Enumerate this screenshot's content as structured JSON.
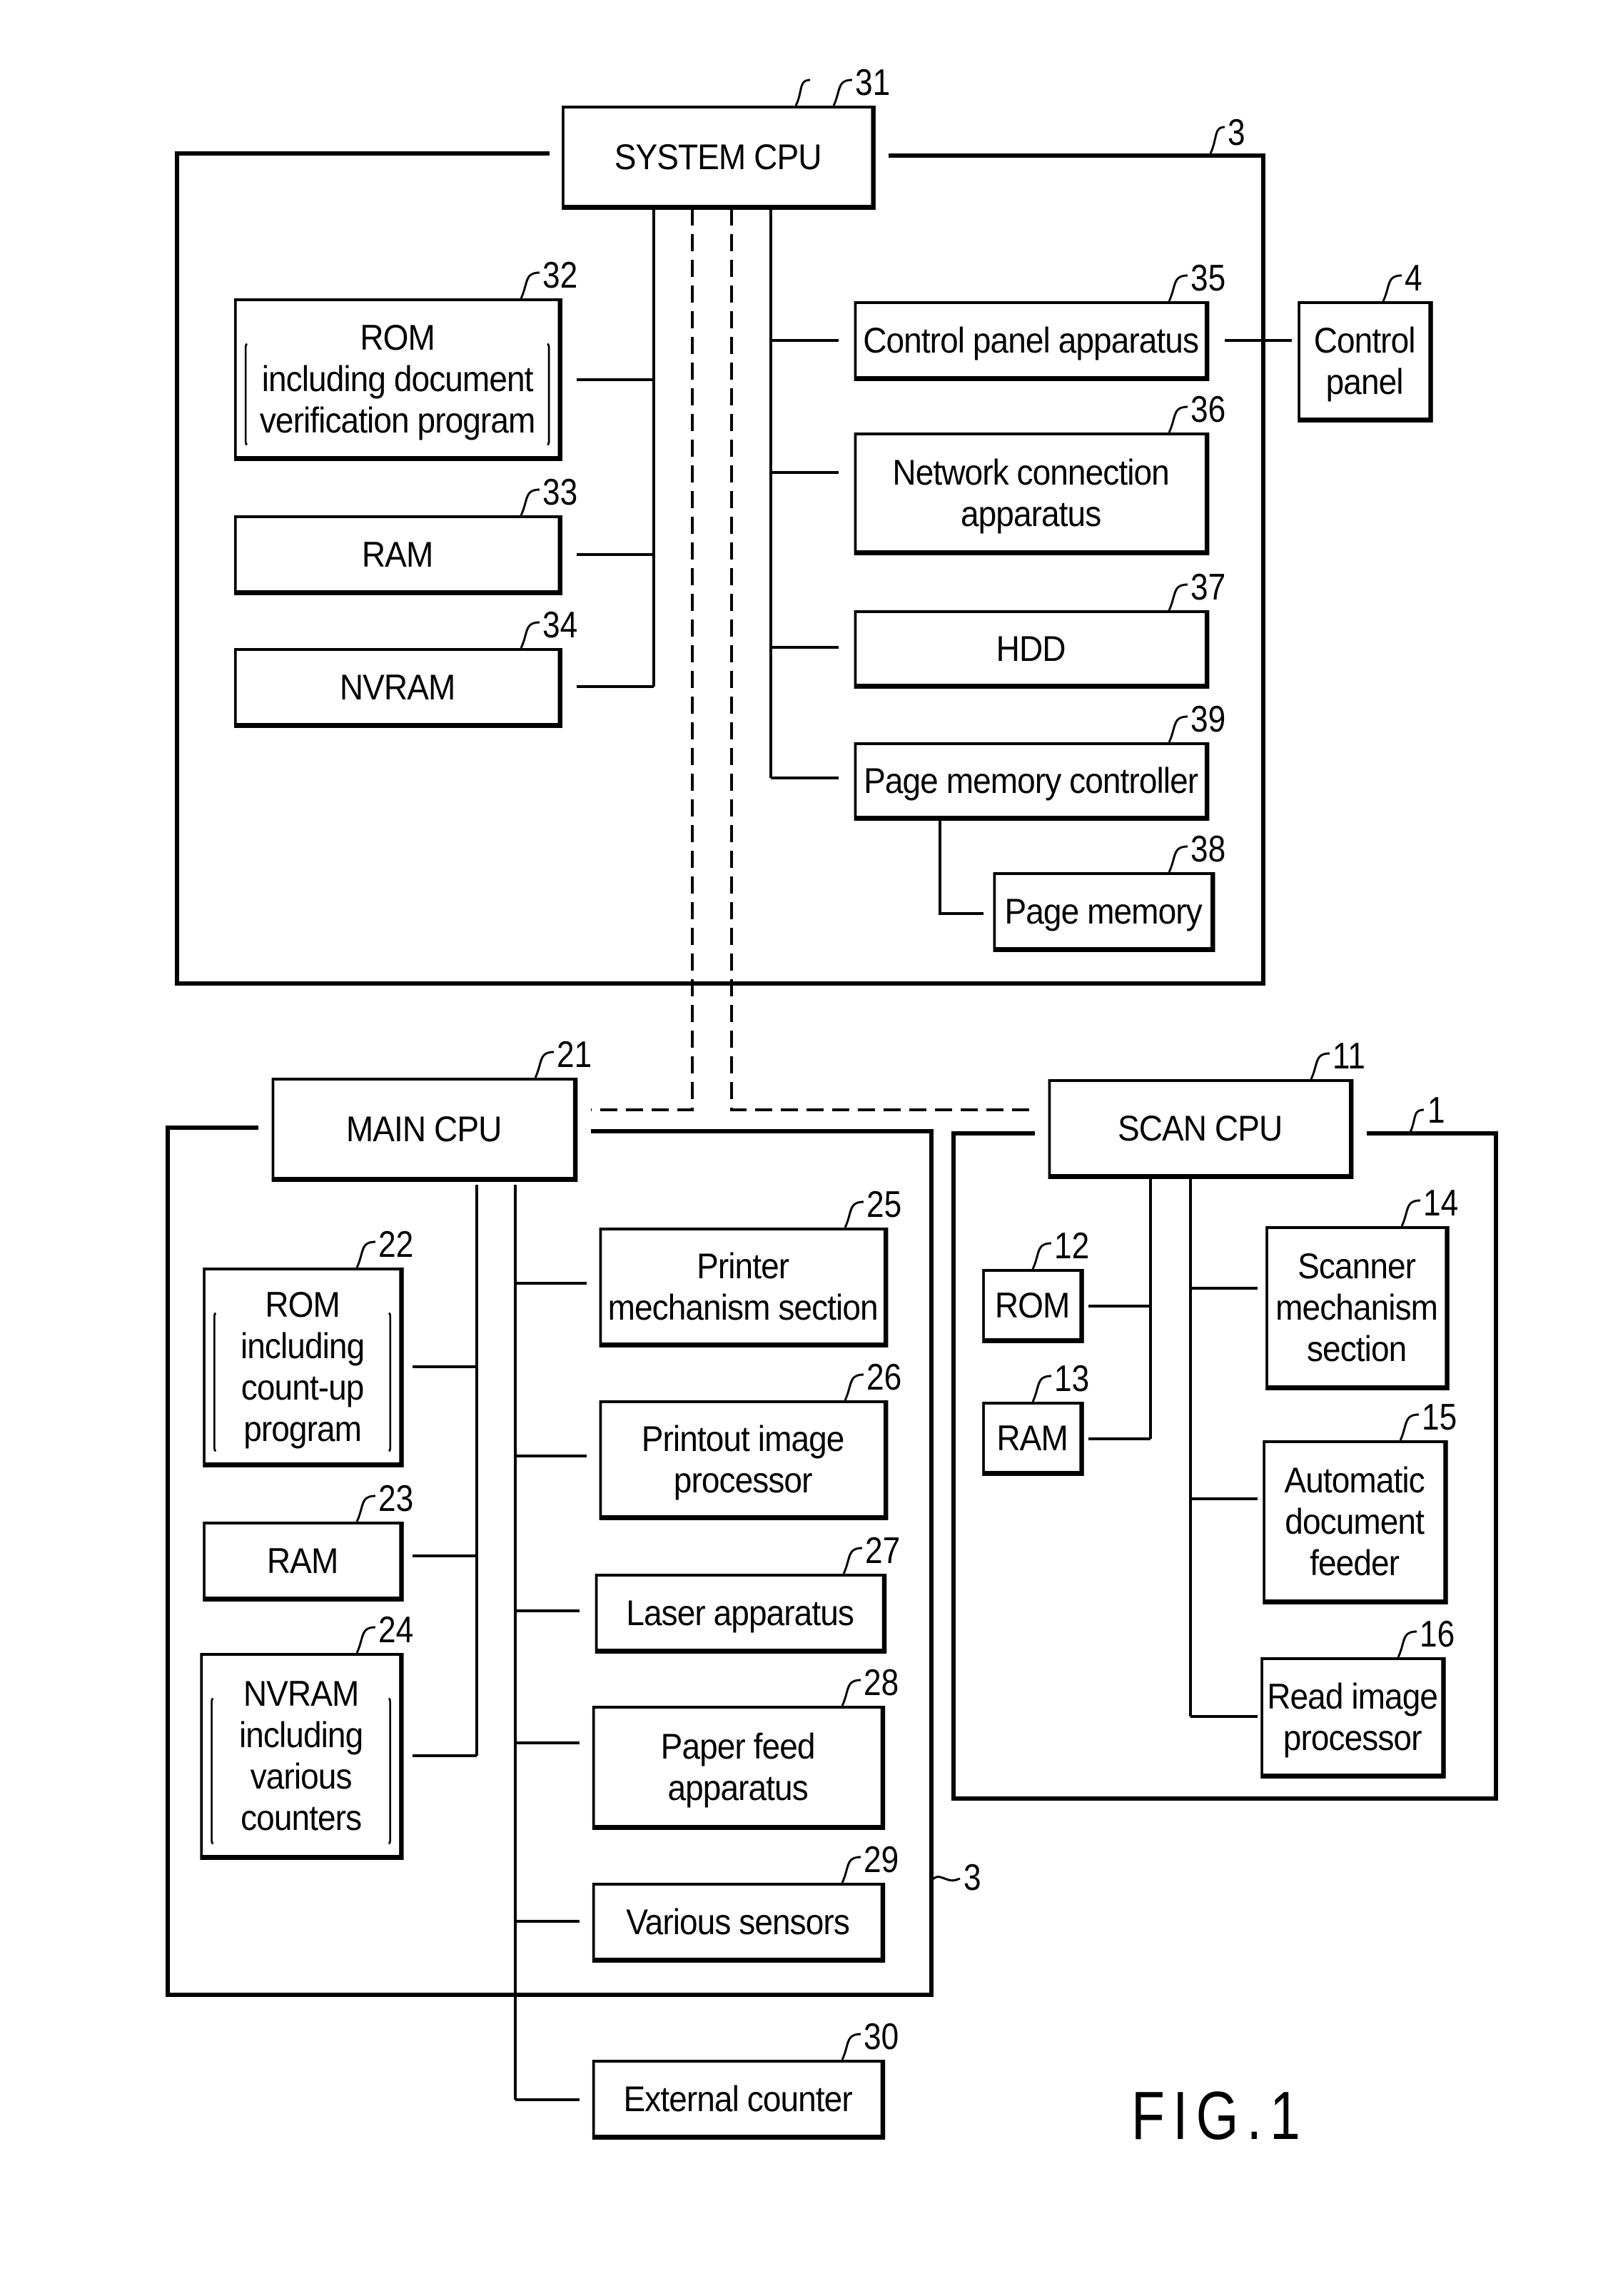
{
  "figure": {
    "title": "FIG.1"
  },
  "groups": {
    "system": {
      "ref": "3"
    },
    "main": {
      "ref": "3"
    },
    "scan": {
      "ref": "1"
    }
  },
  "blocks": {
    "system_cpu": {
      "ref": "31",
      "lines": [
        "SYSTEM CPU"
      ]
    },
    "rom32": {
      "ref": "32",
      "lines": [
        "ROM",
        "including document",
        "verification program"
      ]
    },
    "ram33": {
      "ref": "33",
      "lines": [
        "RAM"
      ]
    },
    "nvram34": {
      "ref": "34",
      "lines": [
        "NVRAM"
      ]
    },
    "cp_app35": {
      "ref": "35",
      "lines": [
        "Control panel apparatus"
      ]
    },
    "control_panel": {
      "ref": "4",
      "lines": [
        "Control",
        "panel"
      ]
    },
    "net36": {
      "ref": "36",
      "lines": [
        "Network connection",
        "apparatus"
      ]
    },
    "hdd37": {
      "ref": "37",
      "lines": [
        "HDD"
      ]
    },
    "pmc39": {
      "ref": "39",
      "lines": [
        "Page memory controller"
      ]
    },
    "pm38": {
      "ref": "38",
      "lines": [
        "Page memory"
      ]
    },
    "main_cpu": {
      "ref": "21",
      "lines": [
        "MAIN CPU"
      ]
    },
    "rom22": {
      "ref": "22",
      "lines": [
        "ROM",
        "including",
        "count-up",
        "program"
      ]
    },
    "ram23": {
      "ref": "23",
      "lines": [
        "RAM"
      ]
    },
    "nvram24": {
      "ref": "24",
      "lines": [
        "NVRAM",
        "including",
        "various",
        "counters"
      ]
    },
    "printer25": {
      "ref": "25",
      "lines": [
        "Printer",
        "mechanism section"
      ]
    },
    "printout26": {
      "ref": "26",
      "lines": [
        "Printout image",
        "processor"
      ]
    },
    "laser27": {
      "ref": "27",
      "lines": [
        "Laser apparatus"
      ]
    },
    "paper28": {
      "ref": "28",
      "lines": [
        "Paper feed",
        "apparatus"
      ]
    },
    "sensors29": {
      "ref": "29",
      "lines": [
        "Various sensors"
      ]
    },
    "extcounter30": {
      "ref": "30",
      "lines": [
        "External counter"
      ]
    },
    "scan_cpu": {
      "ref": "11",
      "lines": [
        "SCAN CPU"
      ]
    },
    "rom12": {
      "ref": "12",
      "lines": [
        "ROM"
      ]
    },
    "ram13": {
      "ref": "13",
      "lines": [
        "RAM"
      ]
    },
    "scanner14": {
      "ref": "14",
      "lines": [
        "Scanner",
        "mechanism",
        "section"
      ]
    },
    "adf15": {
      "ref": "15",
      "lines": [
        "Automatic",
        "document",
        "feeder"
      ]
    },
    "readimg16": {
      "ref": "16",
      "lines": [
        "Read image",
        "processor"
      ]
    }
  }
}
